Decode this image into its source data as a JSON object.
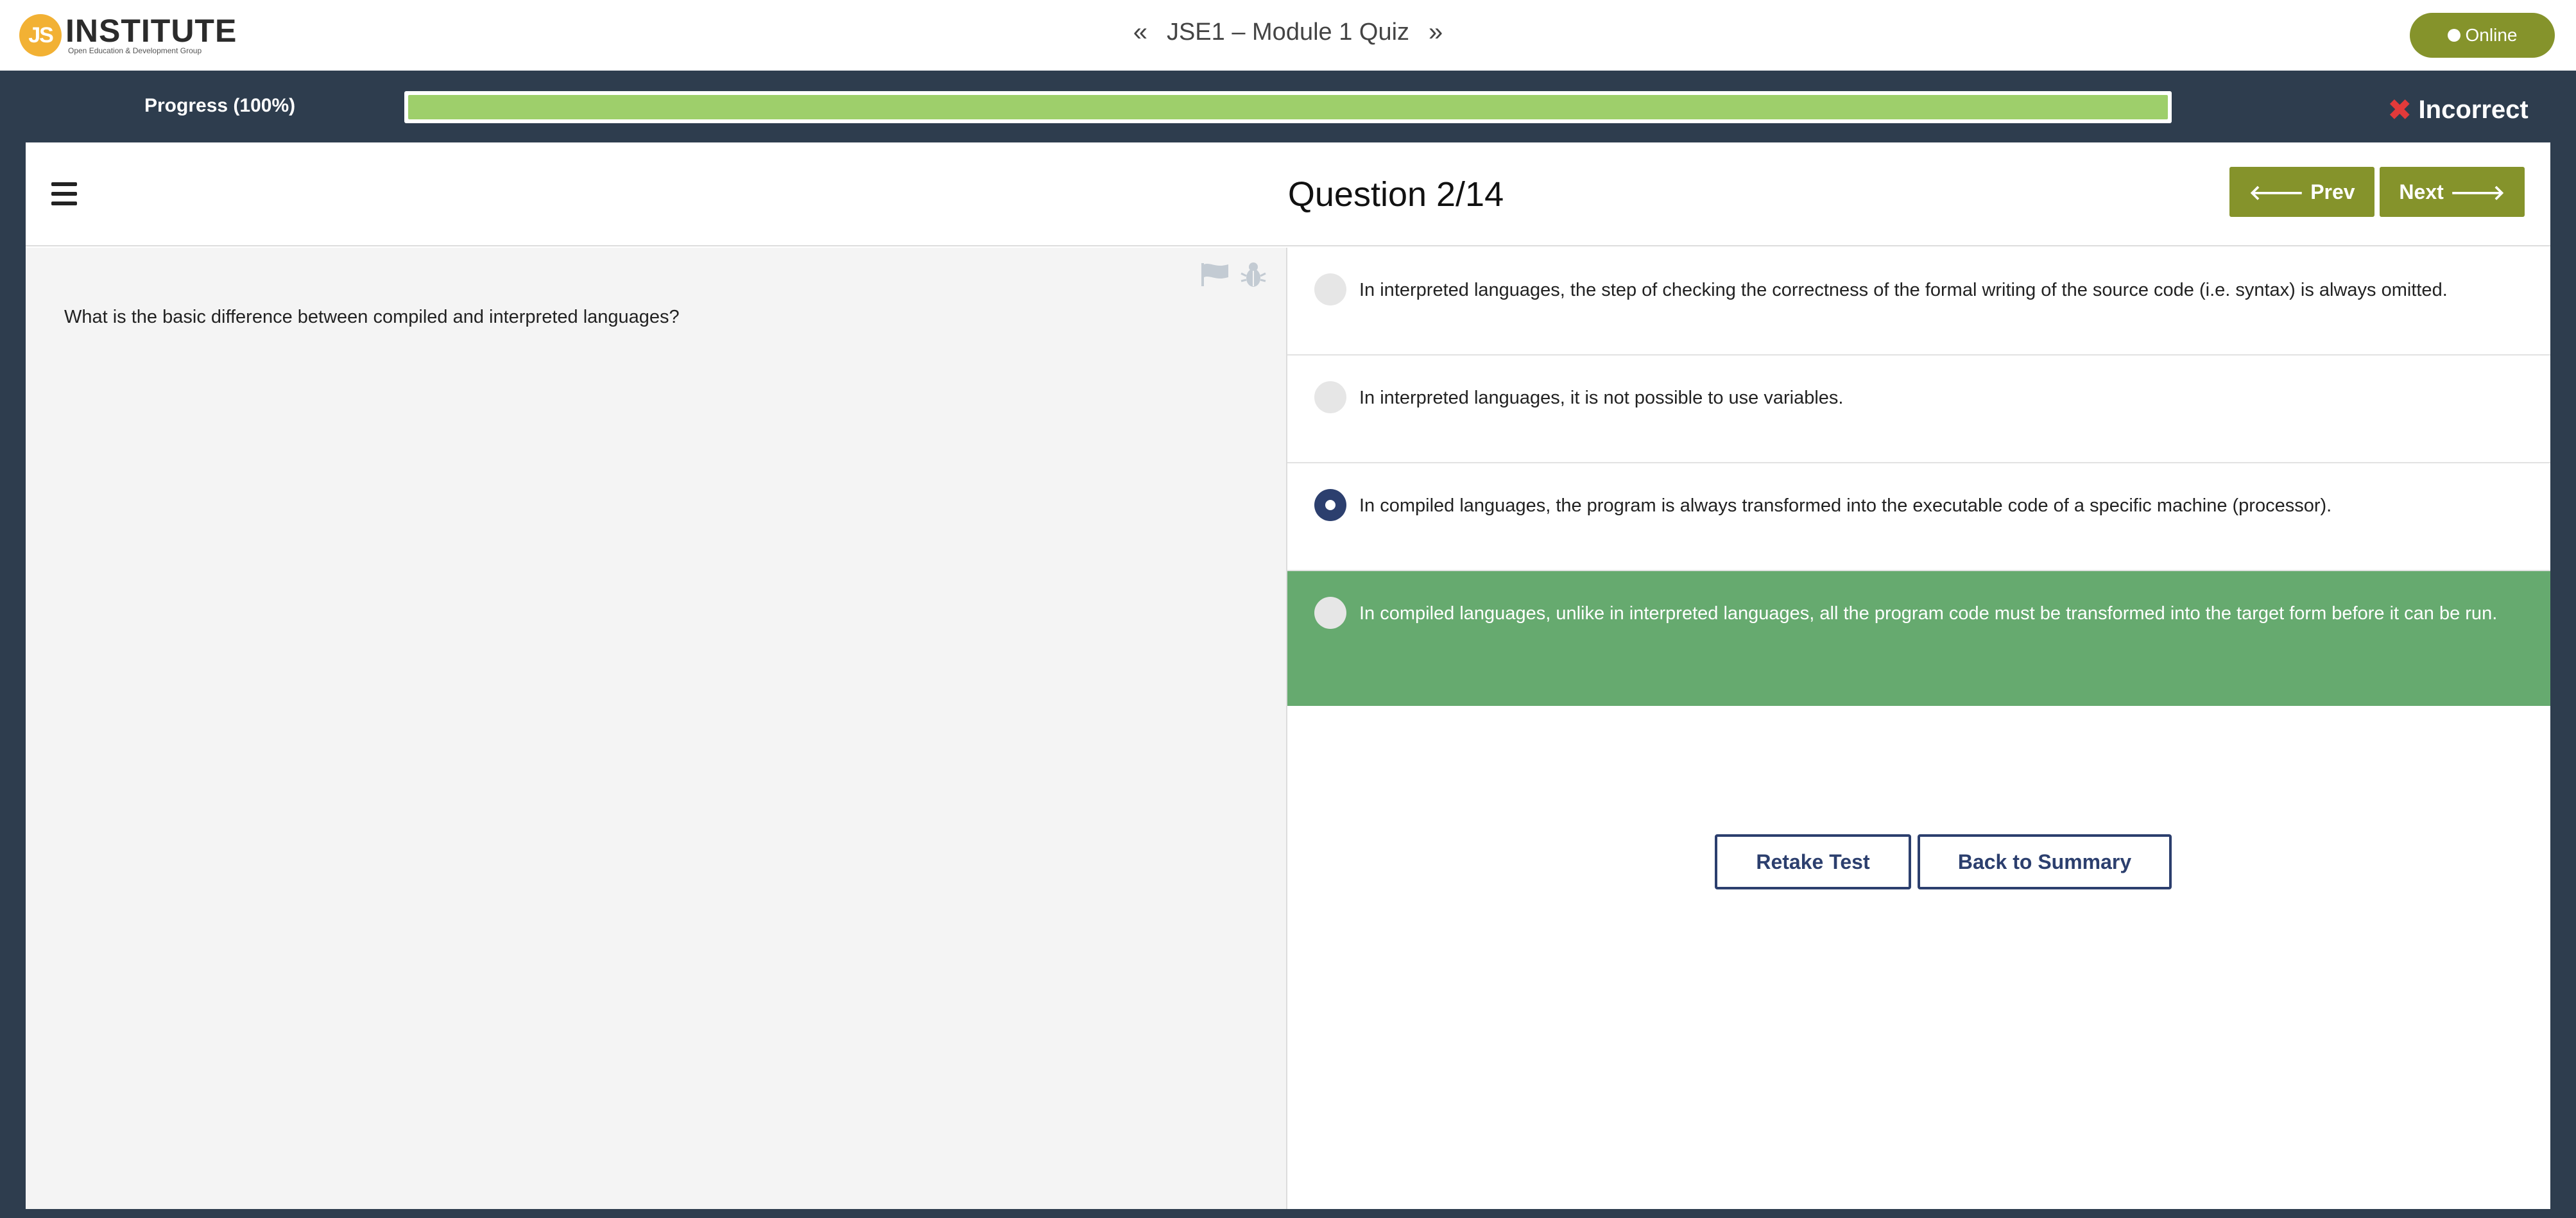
{
  "header": {
    "logo_mark": "JS",
    "logo_word": "INSTITUTE",
    "logo_tagline": "Open Education & Development Group",
    "prev_quiz_icon": "«",
    "quiz_title": "JSE1 – Module 1 Quiz",
    "next_quiz_icon": "»",
    "status_label": "Online"
  },
  "progress": {
    "label": "Progress (100%)",
    "percent": 100,
    "fill_color": "#9ecf6b"
  },
  "result": {
    "icon": "close-icon",
    "label": "Incorrect"
  },
  "question": {
    "title": "Question 2/14",
    "prev_label": "Prev",
    "next_label": "Next",
    "text": "What is the basic difference between compiled and interpreted languages?"
  },
  "answers": [
    {
      "text": "In interpreted languages, the step of checking the correctness of the formal writing of the source code (i.e. syntax) is always omitted.",
      "selected": false,
      "correct": false
    },
    {
      "text": "In interpreted languages, it is not possible to use variables.",
      "selected": false,
      "correct": false
    },
    {
      "text": "In compiled languages, the program is always transformed into the executable code of a specific machine (processor).",
      "selected": true,
      "correct": false
    },
    {
      "text": "In compiled languages, unlike in interpreted languages, all the program code must be transformed into the target form before it can be run.",
      "selected": false,
      "correct": true
    }
  ],
  "actions": {
    "retake_label": "Retake Test",
    "summary_label": "Back to Summary"
  },
  "colors": {
    "accent": "#85932b",
    "dark_bar": "#2e3d4e",
    "correct_bg": "#66aa6f",
    "selected_radio": "#2c3f6e",
    "incorrect_icon": "#e23a3a"
  }
}
